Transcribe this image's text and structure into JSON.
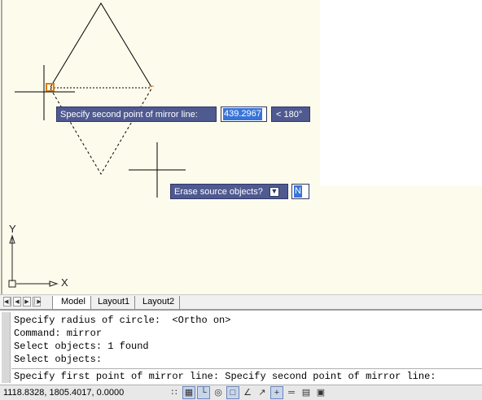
{
  "colors": {
    "canvas_bg": "#fdfbec",
    "tooltip_bg": "#4f5a91",
    "selection": "#3874d8",
    "grip": "#e07a10"
  },
  "drawing": {
    "mirror_tooltip": {
      "prompt": "Specify second point of mirror line:",
      "length_value": "439.2967",
      "angle_value": "< 180°"
    },
    "erase_tooltip": {
      "prompt": "Erase source objects?",
      "value": "N",
      "dropdown_icon": "dropdown-arrow-icon"
    },
    "ucs": {
      "x_label": "X",
      "y_label": "Y"
    }
  },
  "tabs": {
    "nav_icons": [
      "first-tab-icon",
      "prev-tab-icon",
      "next-tab-icon",
      "last-tab-icon"
    ],
    "items": [
      {
        "label": "Model",
        "active": true
      },
      {
        "label": "Layout1",
        "active": false
      },
      {
        "label": "Layout2",
        "active": false
      }
    ]
  },
  "command_history": [
    "Specify radius of circle:  <Ortho on>",
    "Command: mirror",
    "Select objects: 1 found",
    "Select objects:"
  ],
  "command_prompt": "Specify first point of mirror line: Specify second point of mirror line:",
  "status_bar": {
    "coordinates": "1118.8328, 1805.4017, 0.0000",
    "toggles": [
      {
        "icon": "snap-mode-icon",
        "on": false
      },
      {
        "icon": "grid-display-icon",
        "on": true
      },
      {
        "icon": "ortho-mode-icon",
        "on": true
      },
      {
        "icon": "polar-tracking-icon",
        "on": false
      },
      {
        "icon": "object-snap-icon",
        "on": true
      },
      {
        "icon": "object-snap-tracking-icon",
        "on": false
      },
      {
        "icon": "dynamic-ucs-icon",
        "on": false
      },
      {
        "icon": "dynamic-input-icon",
        "on": true
      },
      {
        "icon": "lineweight-icon",
        "on": false
      },
      {
        "icon": "quick-properties-icon",
        "on": false
      },
      {
        "icon": "selection-cycling-icon",
        "on": false
      }
    ]
  }
}
